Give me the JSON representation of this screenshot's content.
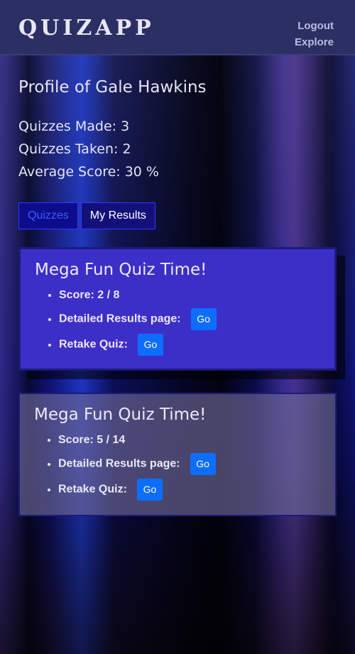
{
  "header": {
    "logo": "QUIZAPP",
    "nav": {
      "logout": "Logout",
      "explore": "Explore"
    }
  },
  "profile": {
    "title": "Profile of Gale Hawkins",
    "stats": {
      "quizzes_made": "Quizzes Made: 3",
      "quizzes_taken": "Quizzes Taken: 2",
      "average_score": "Average Score: 30 %"
    }
  },
  "tabs": {
    "quizzes": "Quizzes",
    "my_results": "My Results"
  },
  "results": [
    {
      "title": "Mega Fun Quiz Time!",
      "score": "Score: 2 / 8",
      "detailed_label": "Detailed Results page:",
      "retake_label": "Retake Quiz:",
      "go_label": "Go"
    },
    {
      "title": "Mega Fun Quiz Time!",
      "score": "Score: 5 / 14",
      "detailed_label": "Detailed Results page:",
      "retake_label": "Retake Quiz:",
      "go_label": "Go"
    }
  ],
  "colors": {
    "header_bg": "#2c2f63",
    "accent_blue": "#0d6efd",
    "card_active": "#3c2fc8",
    "tab_border": "#2b3cff"
  }
}
